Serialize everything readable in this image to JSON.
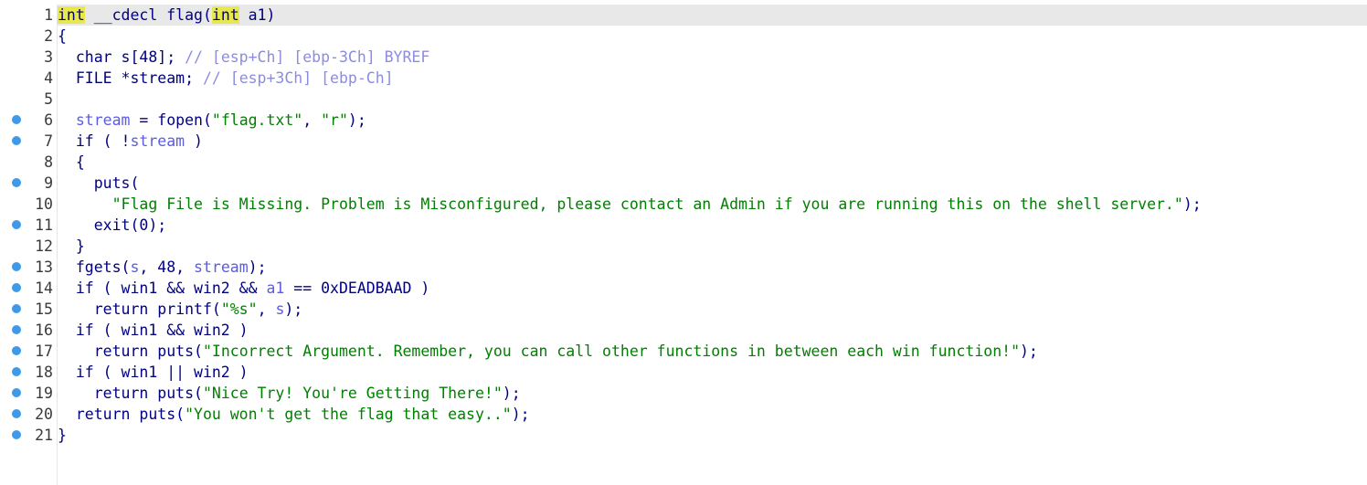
{
  "editor": {
    "accent_breakpoint_color": "#3e9ae8",
    "current_line_bg": "#e8e8e8",
    "highlight_color": "#e8e84a",
    "lines": [
      {
        "num": "1",
        "bp": false,
        "tokens": [
          {
            "t": "int",
            "c": "hl"
          },
          {
            "t": " __cdecl flag(",
            "c": "sig"
          },
          {
            "t": "int",
            "c": "hl"
          },
          {
            "t": " a1)",
            "c": "sig"
          }
        ]
      },
      {
        "num": "2",
        "bp": false,
        "tokens": [
          {
            "t": "{",
            "c": "norm"
          }
        ]
      },
      {
        "num": "3",
        "bp": false,
        "tokens": [
          {
            "t": "  char s[48]; ",
            "c": "norm"
          },
          {
            "t": "// [esp+Ch] [ebp-3Ch] BYREF",
            "c": "com"
          }
        ]
      },
      {
        "num": "4",
        "bp": false,
        "tokens": [
          {
            "t": "  FILE *stream; ",
            "c": "norm"
          },
          {
            "t": "// [esp+3Ch] [ebp-Ch]",
            "c": "com"
          }
        ]
      },
      {
        "num": "5",
        "bp": false,
        "tokens": [
          {
            "t": "",
            "c": "norm"
          }
        ]
      },
      {
        "num": "6",
        "bp": true,
        "tokens": [
          {
            "t": "  ",
            "c": "norm"
          },
          {
            "t": "stream",
            "c": "var"
          },
          {
            "t": " = fopen(",
            "c": "norm"
          },
          {
            "t": "\"flag.txt\"",
            "c": "str"
          },
          {
            "t": ", ",
            "c": "norm"
          },
          {
            "t": "\"r\"",
            "c": "str"
          },
          {
            "t": ");",
            "c": "norm"
          }
        ]
      },
      {
        "num": "7",
        "bp": true,
        "tokens": [
          {
            "t": "  if ( !",
            "c": "norm"
          },
          {
            "t": "stream",
            "c": "var"
          },
          {
            "t": " )",
            "c": "norm"
          }
        ]
      },
      {
        "num": "8",
        "bp": false,
        "tokens": [
          {
            "t": "  {",
            "c": "norm"
          }
        ]
      },
      {
        "num": "9",
        "bp": true,
        "tokens": [
          {
            "t": "    puts(",
            "c": "norm"
          }
        ]
      },
      {
        "num": "10",
        "bp": false,
        "tokens": [
          {
            "t": "      ",
            "c": "norm"
          },
          {
            "t": "\"Flag File is Missing. Problem is Misconfigured, please contact an Admin if you are running this on the shell server.\"",
            "c": "str"
          },
          {
            "t": ");",
            "c": "norm"
          }
        ]
      },
      {
        "num": "11",
        "bp": true,
        "tokens": [
          {
            "t": "    exit(0);",
            "c": "norm"
          }
        ]
      },
      {
        "num": "12",
        "bp": false,
        "tokens": [
          {
            "t": "  }",
            "c": "norm"
          }
        ]
      },
      {
        "num": "13",
        "bp": true,
        "tokens": [
          {
            "t": "  fgets(",
            "c": "norm"
          },
          {
            "t": "s",
            "c": "var"
          },
          {
            "t": ", 48, ",
            "c": "norm"
          },
          {
            "t": "stream",
            "c": "var"
          },
          {
            "t": ");",
            "c": "norm"
          }
        ]
      },
      {
        "num": "14",
        "bp": true,
        "tokens": [
          {
            "t": "  if ( win1 && win2 && ",
            "c": "norm"
          },
          {
            "t": "a1",
            "c": "var"
          },
          {
            "t": " == 0xDEADBAAD )",
            "c": "norm"
          }
        ]
      },
      {
        "num": "15",
        "bp": true,
        "tokens": [
          {
            "t": "    return printf(",
            "c": "norm"
          },
          {
            "t": "\"%s\"",
            "c": "str"
          },
          {
            "t": ", ",
            "c": "norm"
          },
          {
            "t": "s",
            "c": "var"
          },
          {
            "t": ");",
            "c": "norm"
          }
        ]
      },
      {
        "num": "16",
        "bp": true,
        "tokens": [
          {
            "t": "  if ( win1 && win2 )",
            "c": "norm"
          }
        ]
      },
      {
        "num": "17",
        "bp": true,
        "tokens": [
          {
            "t": "    return puts(",
            "c": "norm"
          },
          {
            "t": "\"Incorrect Argument. Remember, you can call other functions in between each win function!\"",
            "c": "str"
          },
          {
            "t": ");",
            "c": "norm"
          }
        ]
      },
      {
        "num": "18",
        "bp": true,
        "tokens": [
          {
            "t": "  if ( win1 || win2 )",
            "c": "norm"
          }
        ]
      },
      {
        "num": "19",
        "bp": true,
        "tokens": [
          {
            "t": "    return puts(",
            "c": "norm"
          },
          {
            "t": "\"Nice Try! You're Getting There!\"",
            "c": "str"
          },
          {
            "t": ");",
            "c": "norm"
          }
        ]
      },
      {
        "num": "20",
        "bp": true,
        "tokens": [
          {
            "t": "  return puts(",
            "c": "norm"
          },
          {
            "t": "\"You won't get the flag that easy..\"",
            "c": "str"
          },
          {
            "t": ");",
            "c": "norm"
          }
        ]
      },
      {
        "num": "21",
        "bp": true,
        "tokens": [
          {
            "t": "}",
            "c": "norm"
          }
        ]
      }
    ]
  }
}
